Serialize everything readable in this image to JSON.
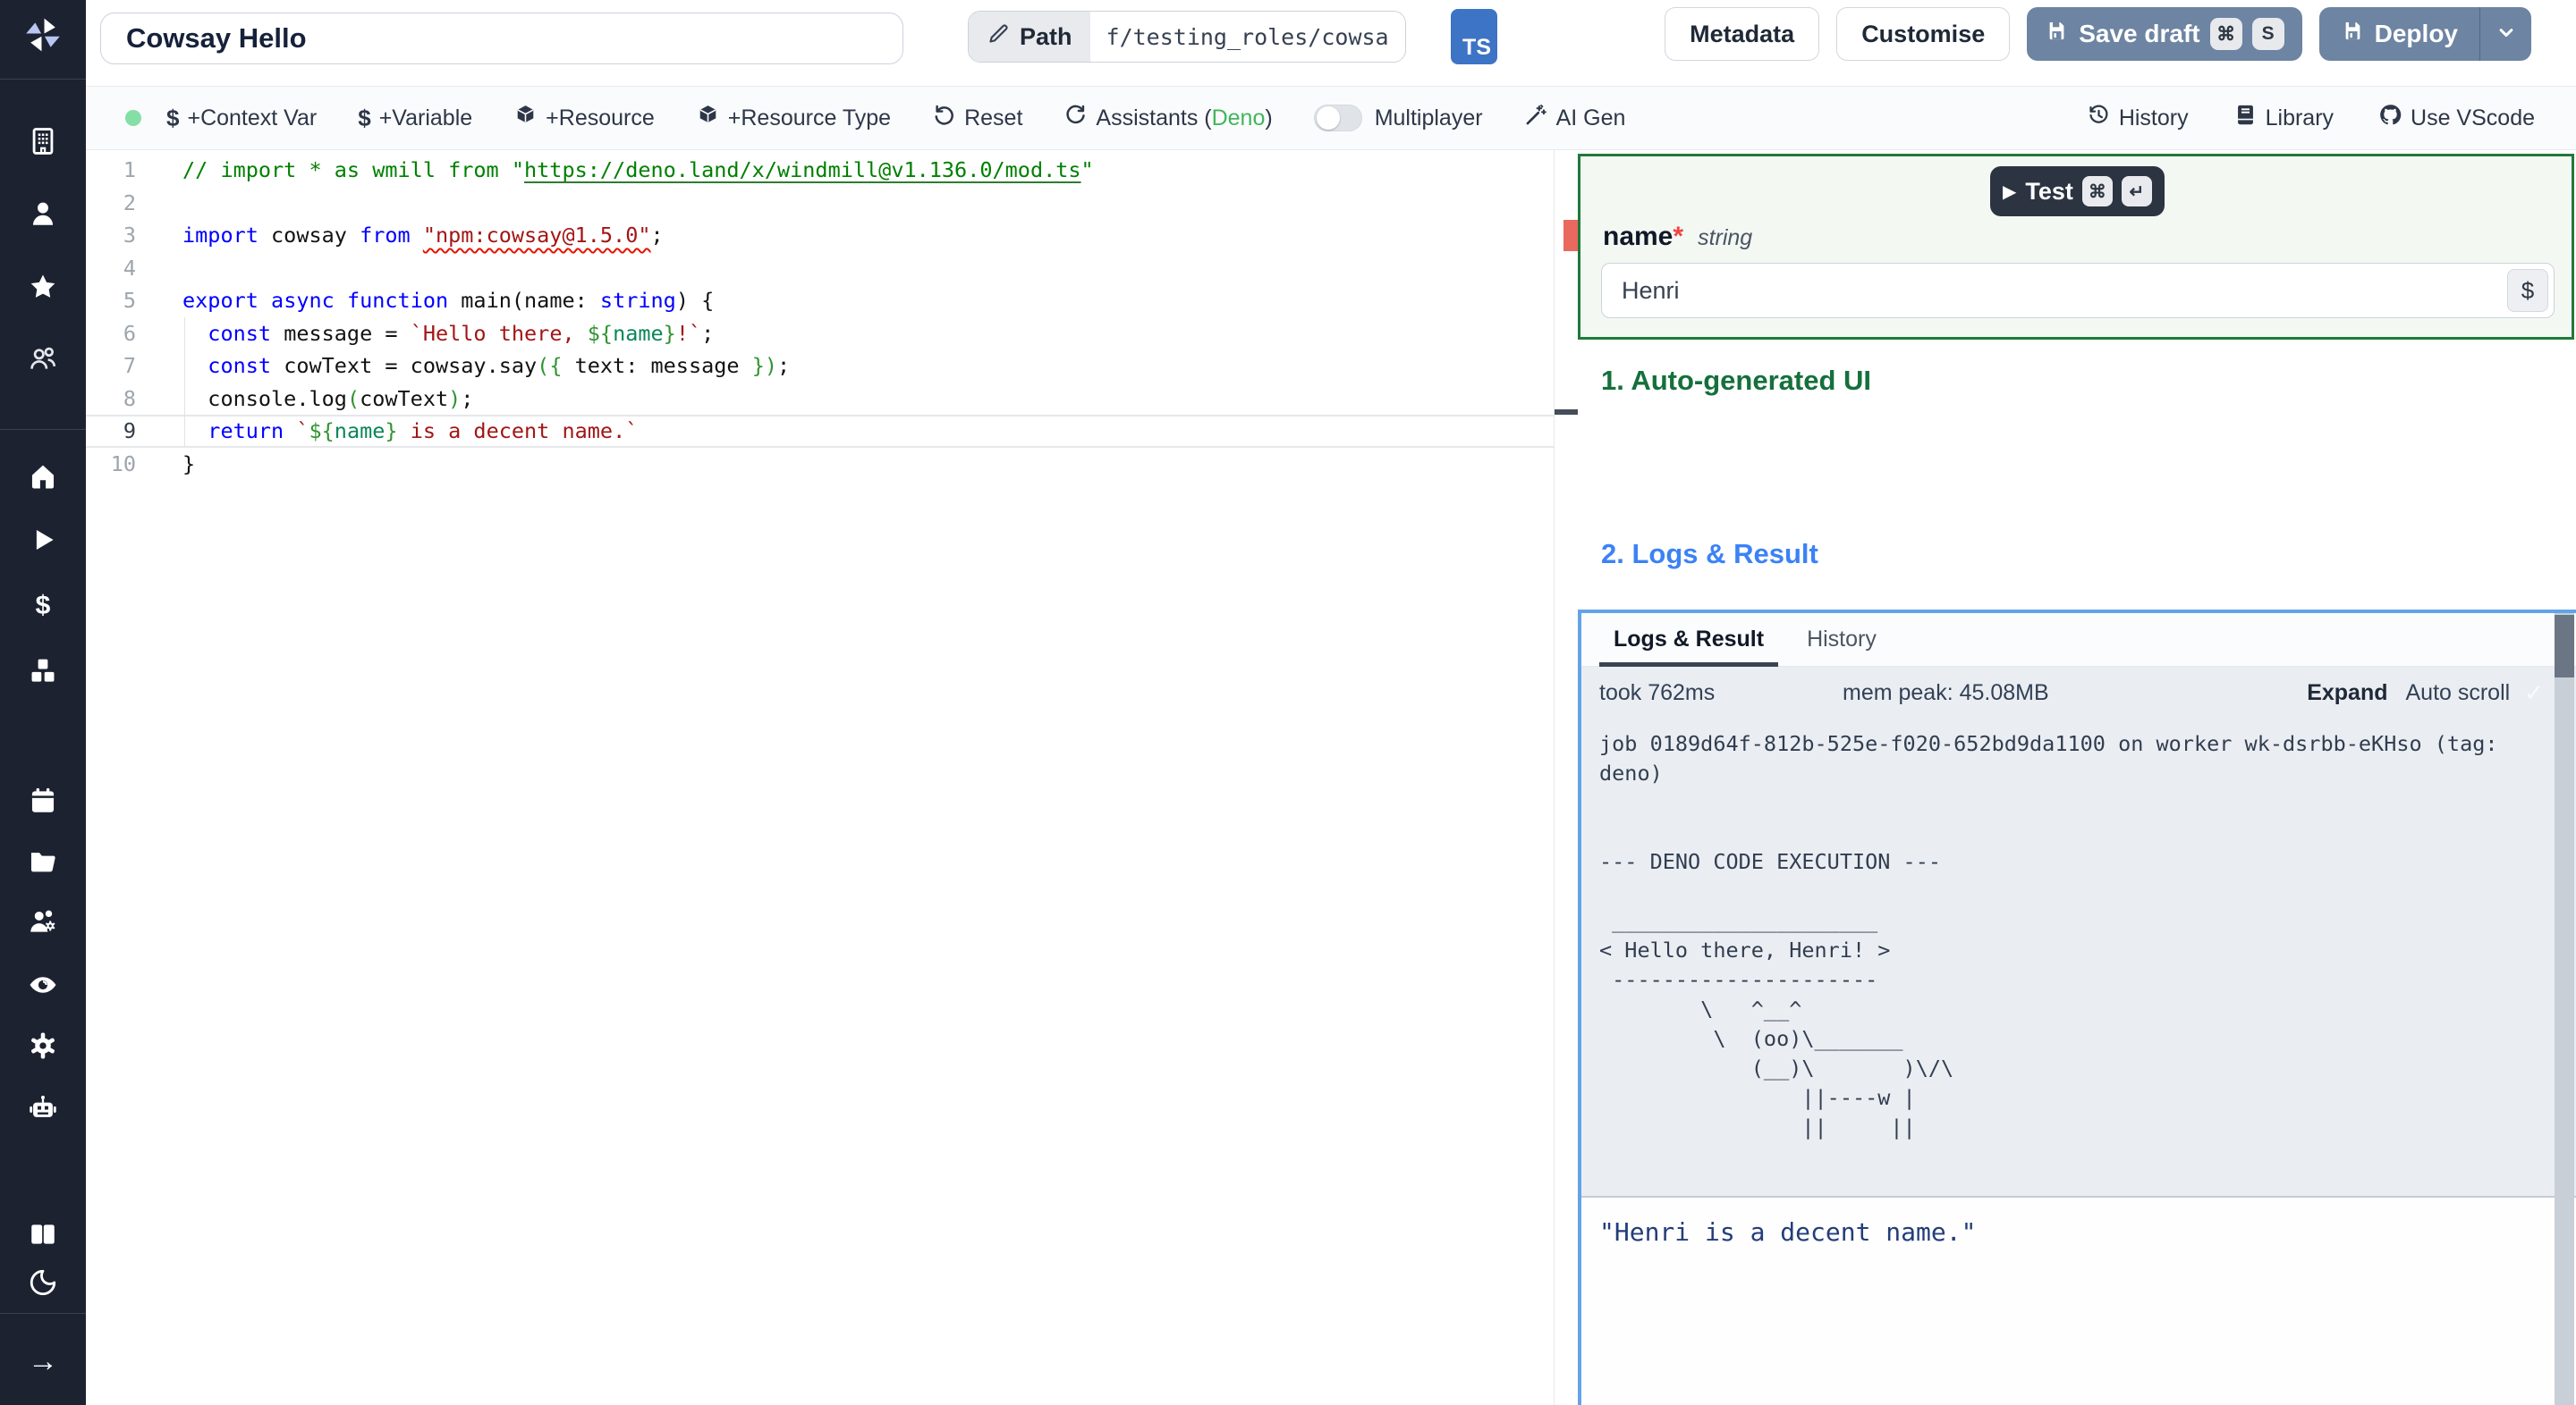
{
  "header": {
    "title_value": "Cowsay Hello",
    "path_label": "Path",
    "path_value": "f/testing_roles/cowsa",
    "lang_badge": "TS",
    "metadata_label": "Metadata",
    "customise_label": "Customise",
    "save_draft_label": "Save draft",
    "save_kbd_mod": "⌘",
    "save_kbd_key": "S",
    "deploy_label": "Deploy"
  },
  "toolbar": {
    "dollar_icon": "$",
    "context_var": "+Context Var",
    "variable": "+Variable",
    "resource": "+Resource",
    "resource_type": "+Resource Type",
    "reset": "Reset",
    "assistants_pre": "Assistants (",
    "assistants_lang": "Deno",
    "assistants_post": ")",
    "multiplayer": "Multiplayer",
    "ai_gen": "AI Gen",
    "history": "History",
    "library": "Library",
    "use_vscode": "Use VScode"
  },
  "sidebar": {
    "icons": [
      "building",
      "person",
      "star",
      "users",
      "home",
      "play",
      "dollar",
      "cubes",
      "calendar",
      "folder",
      "users-gear",
      "eye",
      "gear",
      "robot",
      "book",
      "moon",
      "arrow-right"
    ]
  },
  "editor": {
    "current_line": 9,
    "lines": [
      {
        "n": 1,
        "t": [
          [
            "c",
            "// import * as wmill from \""
          ],
          [
            "cl",
            "https://deno.land/x/windmill@v1.136.0/mod.ts"
          ],
          [
            "c",
            "\""
          ]
        ]
      },
      {
        "n": 2,
        "t": []
      },
      {
        "n": 3,
        "t": [
          [
            "k",
            "import"
          ],
          [
            "d",
            " cowsay "
          ],
          [
            "k",
            "from"
          ],
          [
            "d",
            " "
          ],
          [
            "se",
            "\"npm:cowsay@1.5.0\""
          ],
          [
            "d",
            ";"
          ]
        ]
      },
      {
        "n": 4,
        "t": []
      },
      {
        "n": 5,
        "t": [
          [
            "k",
            "export"
          ],
          [
            "d",
            " "
          ],
          [
            "k",
            "async"
          ],
          [
            "d",
            " "
          ],
          [
            "k",
            "function"
          ],
          [
            "d",
            " main(name: "
          ],
          [
            "k",
            "string"
          ],
          [
            "d",
            ") {"
          ]
        ]
      },
      {
        "n": 6,
        "t": [
          [
            "d",
            "  "
          ],
          [
            "k",
            "const"
          ],
          [
            "d",
            " message = "
          ],
          [
            "s",
            "`Hello there, "
          ],
          [
            "p",
            "${"
          ],
          [
            "g",
            "name"
          ],
          [
            "p",
            "}"
          ],
          [
            "s",
            "!`"
          ],
          [
            "d",
            ";"
          ]
        ]
      },
      {
        "n": 7,
        "t": [
          [
            "d",
            "  "
          ],
          [
            "k",
            "const"
          ],
          [
            "d",
            " cowText = cowsay.say"
          ],
          [
            "p",
            "({"
          ],
          [
            "d",
            " text: message "
          ],
          [
            "p",
            "})"
          ],
          [
            "d",
            ";"
          ]
        ]
      },
      {
        "n": 8,
        "t": [
          [
            "d",
            "  console.log"
          ],
          [
            "p",
            "("
          ],
          [
            "d",
            "cowText"
          ],
          [
            "p",
            ")"
          ],
          [
            "d",
            ";"
          ]
        ]
      },
      {
        "n": 9,
        "t": [
          [
            "d",
            "  "
          ],
          [
            "k",
            "return"
          ],
          [
            "d",
            " "
          ],
          [
            "s",
            "`"
          ],
          [
            "p",
            "${"
          ],
          [
            "g",
            "name"
          ],
          [
            "p",
            "}"
          ],
          [
            "s",
            " is a decent name.`"
          ]
        ]
      },
      {
        "n": 10,
        "t": [
          [
            "d",
            "}"
          ]
        ]
      }
    ]
  },
  "args": {
    "test_label": "Test",
    "test_play_icon": "▶",
    "test_kbd_mod": "⌘",
    "test_kbd_enter": "↵",
    "field_name": "name",
    "required_mark": "*",
    "field_type": "string",
    "field_value": "Henri",
    "var_picker_label": "$"
  },
  "sections": {
    "ui_title": "1. Auto-generated UI",
    "logs_title": "2. Logs & Result"
  },
  "logs": {
    "tab_active": "Logs & Result",
    "tab_history": "History",
    "took": "took 762ms",
    "mem_peak": "mem peak: 45.08MB",
    "expand": "Expand",
    "autoscroll": "Auto scroll",
    "autoscroll_check": "✓",
    "log_lines": [
      "job 0189d64f-812b-525e-f020-652bd9da1100 on worker wk-dsrbb-eKHso (tag:",
      "deno)",
      "",
      "",
      "--- DENO CODE EXECUTION ---",
      "",
      " _____________________",
      "< Hello there, Henri! >",
      " ---------------------",
      "        \\   ^__^",
      "         \\  (oo)\\_______",
      "            (__)\\       )\\/\\",
      "                ||----w |",
      "                ||     ||"
    ],
    "result_value": "\"Henri is a decent name.\""
  }
}
